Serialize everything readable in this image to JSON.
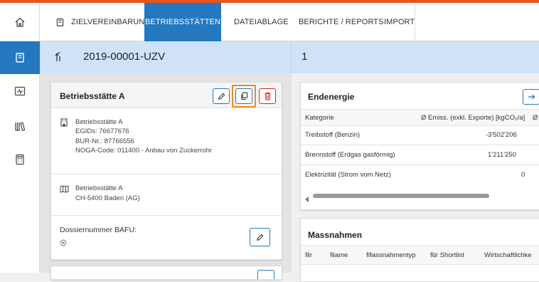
{
  "colors": {
    "accent": "#2378c0",
    "header_bg": "#cfe3f8",
    "highlight": "#f08a1e",
    "danger": "#dd2222",
    "topbar": "#e8541e"
  },
  "rail": {
    "icons": [
      "home-icon",
      "notebook-icon",
      "chart-icon",
      "books-icon",
      "calculator-icon"
    ]
  },
  "nav": {
    "tabs": [
      {
        "label": "ZIELVEREINBARUNG"
      },
      {
        "label": "BETRIEBSSTÄTTEN"
      },
      {
        "label": "DATEIABLAGE"
      },
      {
        "label": "BERICHTE / REPORTS"
      },
      {
        "label": "IMPORT"
      }
    ]
  },
  "header": {
    "dossier_id": "2019-00001-UZV",
    "right_value": "1"
  },
  "betrieb": {
    "title": "Betriebsstätte A",
    "section1": {
      "name": "Betriebsstätte A",
      "egid": "EGIDs: 76677676",
      "bur": "BUR-Nr.: 87766556",
      "noga": "NOGA-Code: 011400 - Anbau von Zuckerrohr"
    },
    "section2": {
      "name": "Betriebsstätte A",
      "address": "CH-5400 Baden (AG)"
    },
    "dossier_label": "Dossiernummer BAFU:"
  },
  "endenergie": {
    "title": "Endenergie",
    "columns": [
      "Kategorie",
      "Ø Emiss. (exkl. Exporte) [kgCO₂/a]",
      "Ø"
    ],
    "rows": [
      {
        "kategorie": "Treibstoff (Benzin)",
        "wert": "-3'502'206"
      },
      {
        "kategorie": "Brennstoff (Erdgas gasförmig)",
        "wert": "1'211'250"
      },
      {
        "kategorie": "Elektrizität (Strom vom Netz)",
        "wert": "0"
      }
    ]
  },
  "massnahmen": {
    "title": "Massnahmen",
    "columns": [
      "Nr",
      "Name",
      "Massnahmentyp",
      "für Shortlist",
      "Wirtschaftlichke"
    ]
  }
}
